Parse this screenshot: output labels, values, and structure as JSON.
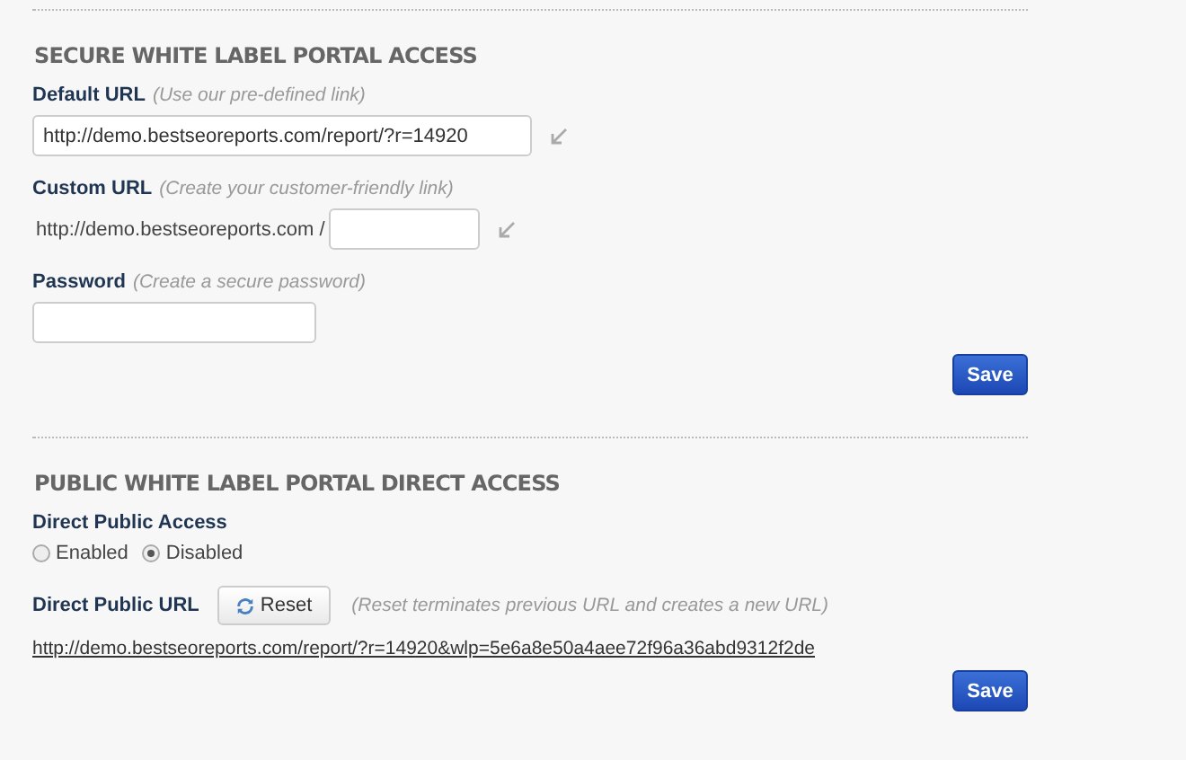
{
  "sections": [
    {
      "title": "SECURE WHITE LABEL PORTAL ACCESS",
      "fields": [
        {
          "kind": "input",
          "label": "Default URL",
          "hint": "(Use our pre-defined link)",
          "value": "http://demo.bestseoreports.com/report/?r=14920",
          "wide": true,
          "link_icon": true
        },
        {
          "kind": "prefixed",
          "label": "Custom URL",
          "hint": "(Create your customer-friendly link)",
          "prefix": "http://demo.bestseoreports.com /",
          "link_icon": true
        },
        {
          "kind": "input",
          "label": "Password",
          "hint": "(Create a secure password)",
          "wide": false,
          "link_icon": false
        }
      ],
      "save": "Save"
    },
    {
      "title": "PUBLIC WHITE LABEL PORTAL DIRECT ACCESS",
      "fields": [
        {
          "kind": "radio",
          "label": "Direct Public Access",
          "options": [
            {
              "label": "Enabled",
              "selected": false
            },
            {
              "label": "Disabled",
              "selected": true
            }
          ]
        },
        {
          "kind": "reset",
          "label": "Direct Public URL",
          "button": "Reset",
          "hint": "(Reset terminates previous URL and creates a new URL)",
          "url": "http://demo.bestseoreports.com/report/?r=14920&wlp=5e6a8e50a4aee72f96a36abd9312f2de"
        }
      ],
      "save": "Save"
    }
  ]
}
